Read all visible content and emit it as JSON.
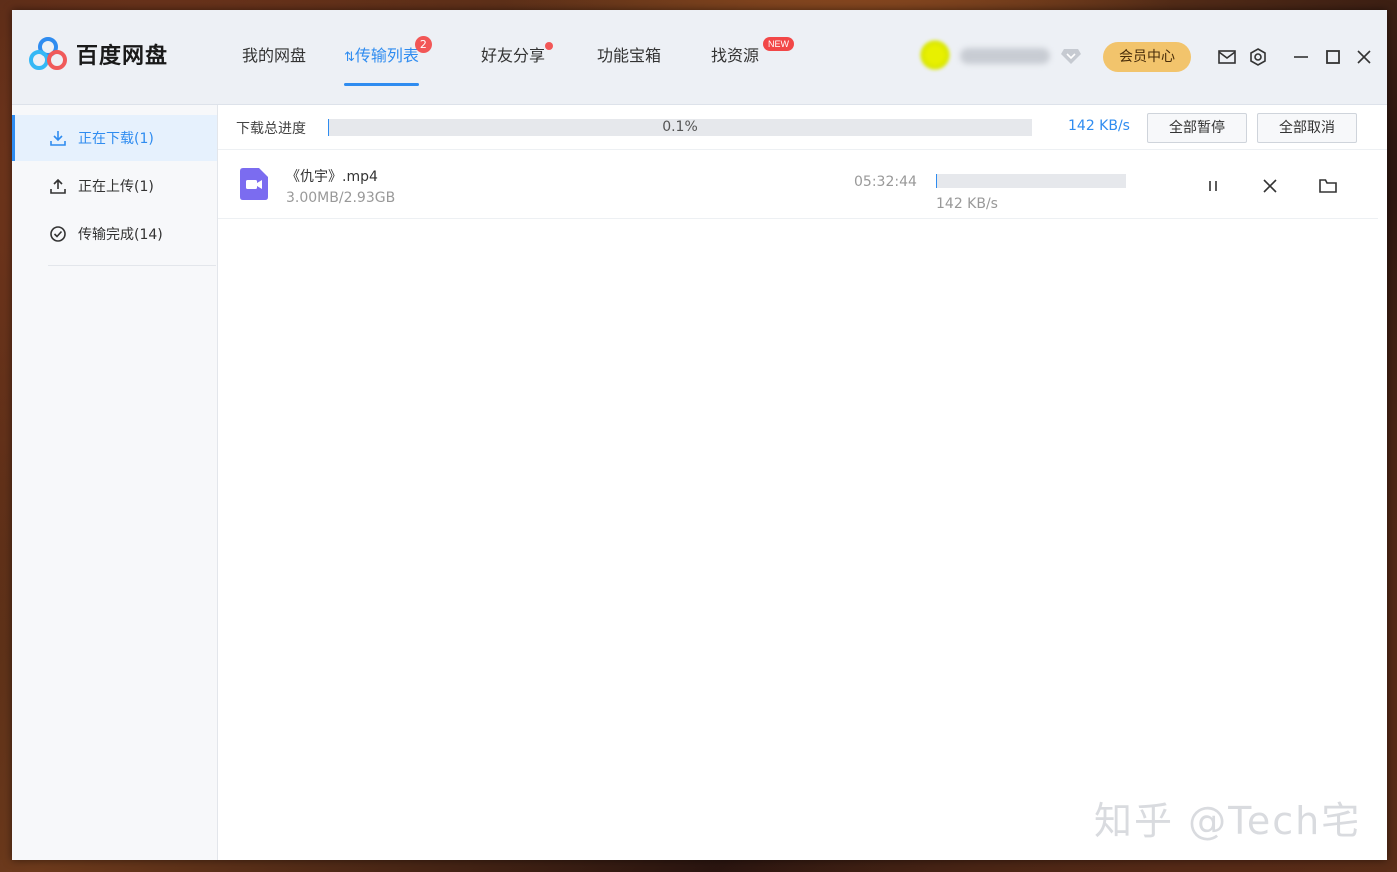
{
  "app": {
    "name": "百度网盘"
  },
  "nav": {
    "items": [
      {
        "label": "我的网盘"
      },
      {
        "label": "传输列表",
        "badge": "2",
        "active": true
      },
      {
        "label": "好友分享",
        "dot": true
      },
      {
        "label": "功能宝箱"
      },
      {
        "label": "找资源",
        "badge": "NEW"
      }
    ]
  },
  "user": {
    "vip_label": "会员中心"
  },
  "sidebar": {
    "items": [
      {
        "label": "正在下载(1)",
        "icon": "download-icon",
        "active": true
      },
      {
        "label": "正在上传(1)",
        "icon": "upload-icon"
      },
      {
        "label": "传输完成(14)",
        "icon": "check-circle-icon"
      }
    ]
  },
  "total": {
    "label": "下载总进度",
    "percent_text": "0.1%",
    "progress": 0.001,
    "speed": "142 KB/s",
    "pause_all": "全部暂停",
    "cancel_all": "全部取消"
  },
  "downloads": [
    {
      "name": "《仇宇》.mp4",
      "size": "3.00MB/2.93GB",
      "remaining": "05:32:44",
      "progress": 0.001,
      "speed": "142 KB/s"
    }
  ],
  "watermark": "知乎 @Tech宅",
  "colors": {
    "accent": "#2f8cf0",
    "badge": "#f25757",
    "vip": "#f2c46c",
    "file_video": "#7b6cf0"
  }
}
